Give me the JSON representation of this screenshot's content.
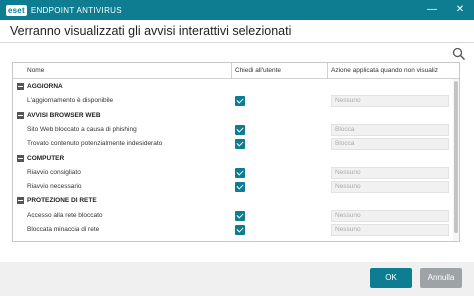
{
  "window": {
    "logo": "eset",
    "product": "ENDPOINT ANTIVIRUS",
    "minimize": "—",
    "close": "✕"
  },
  "dialog": {
    "title": "Verranno visualizzati gli avvisi interattivi selezionati"
  },
  "table": {
    "columns": {
      "name": "Nome",
      "ask": "Chiedi all'utente",
      "action": "Azione applicata quando non visualiz"
    },
    "groups": [
      {
        "title": "AGGIORNA",
        "items": [
          {
            "name": "L'aggiornamento è disponibile",
            "ask": true,
            "action": "Nessuno"
          }
        ]
      },
      {
        "title": "AVVISI BROWSER WEB",
        "items": [
          {
            "name": "Sito Web bloccato a causa di phishing",
            "ask": true,
            "action": "Blocca"
          },
          {
            "name": "Trovato contenuto potenzialmente indesiderato",
            "ask": true,
            "action": "Blocca"
          }
        ]
      },
      {
        "title": "COMPUTER",
        "items": [
          {
            "name": "Riavvio consigliato",
            "ask": true,
            "action": "Nessuno"
          },
          {
            "name": "Riavvio necessario",
            "ask": true,
            "action": "Nessuno"
          }
        ]
      },
      {
        "title": "PROTEZIONE DI RETE",
        "items": [
          {
            "name": "Accesso alla rete bloccato",
            "ask": true,
            "action": "Nessuno"
          },
          {
            "name": "Bloccata minaccia di rete",
            "ask": true,
            "action": "Nessuno"
          }
        ]
      }
    ]
  },
  "buttons": {
    "ok": "OK",
    "cancel": "Annulla"
  },
  "colors": {
    "accent": "#0e7d92",
    "cancel": "#9ea3a6"
  }
}
